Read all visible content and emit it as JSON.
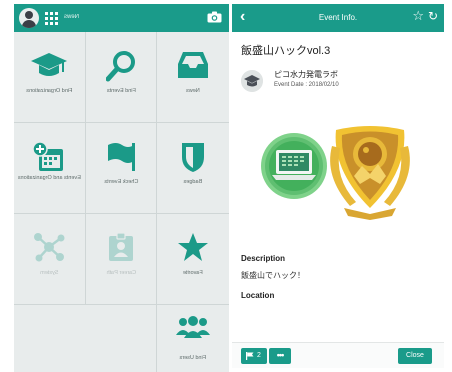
{
  "colors": {
    "accent": "#1a9b8a",
    "tile_icon": "#1b9a88",
    "panel_bg": "#e8ecec"
  },
  "left": {
    "header": {
      "title": "News",
      "icons": [
        "avatar-icon",
        "apps-grid-icon",
        "camera-icon"
      ]
    },
    "tiles": [
      {
        "label": "News",
        "icon": "inbox-icon",
        "dim": false
      },
      {
        "label": "Find Events",
        "icon": "search-icon",
        "dim": false
      },
      {
        "label": "Find Organizations",
        "icon": "graduation-cap-icon",
        "dim": false
      },
      {
        "label": "Badges",
        "icon": "shield-icon",
        "dim": false
      },
      {
        "label": "Check Events",
        "icon": "flag-icon",
        "dim": false
      },
      {
        "label": "Events and Organizations",
        "icon": "calendar-plus-icon",
        "dim": false
      },
      {
        "label": "Favorite",
        "icon": "star-icon",
        "dim": false
      },
      {
        "label": "Career Path",
        "icon": "id-badge-icon",
        "dim": true
      },
      {
        "label": "System",
        "icon": "network-icon",
        "dim": true
      },
      {
        "label": "Find Users",
        "icon": "users-icon",
        "dim": false
      }
    ]
  },
  "right": {
    "header": {
      "title": "Event Info.",
      "icons": [
        "back-icon",
        "star-outline-icon",
        "refresh-icon"
      ]
    },
    "event_title": "飯盛山ハックvol.3",
    "organizer": {
      "name": "ピコ水力発電ラボ",
      "date_label": "Event Date : 2018/02/10"
    },
    "description_heading": "Description",
    "description_text": "飯盛山でハック！",
    "location_heading": "Location",
    "footer": {
      "flag_count": "2",
      "more_label": "•••",
      "close_label": "Close"
    }
  }
}
